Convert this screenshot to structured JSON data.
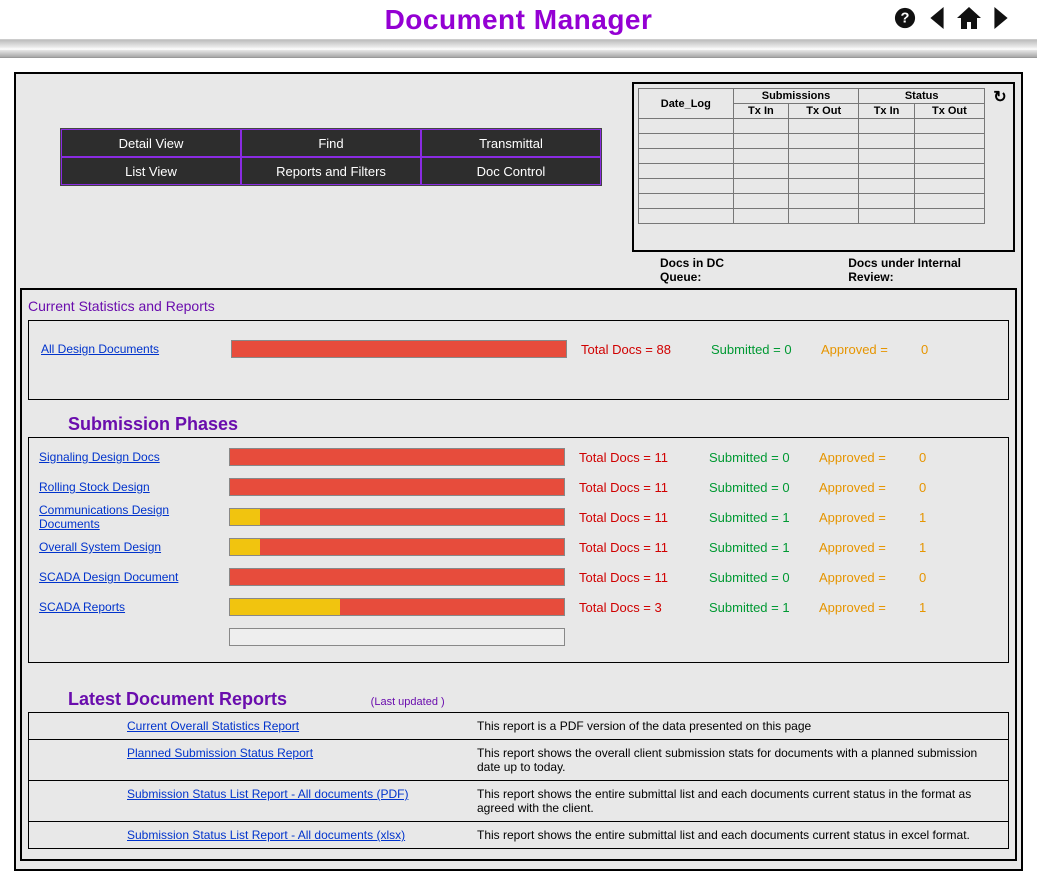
{
  "title": "Document Manager",
  "buttons": {
    "r1c1": "Detail View",
    "r1c2": "Find",
    "r1c3": "Transmittal",
    "r2c1": "List View",
    "r2c2": "Reports and Filters",
    "r2c3": "Doc Control"
  },
  "status_table": {
    "group1": "Submissions",
    "group2": "Status",
    "col_date": "Date_Log",
    "col_txin": "Tx In",
    "col_txout": "Tx Out",
    "col_txin2": "Tx In",
    "col_txout2": "Tx Out"
  },
  "footer": {
    "dc_queue_label": "Docs in DC Queue:",
    "internal_label": "Docs under Internal Review:"
  },
  "stats_title": "Current Statistics and Reports",
  "all_design": {
    "label": "All Design Documents",
    "total": "Total Docs = 88",
    "submitted": "Submitted =  0",
    "approved_lbl": "Approved =",
    "approved_val": "0"
  },
  "phases_title": "Submission Phases",
  "phases": [
    {
      "label": "Signaling Design Docs",
      "total": "Total Docs = 11",
      "submitted": "Submitted = 0",
      "appr_lbl": "Approved =",
      "appr": "0",
      "orange": 0,
      "red": 100
    },
    {
      "label": "Rolling Stock Design",
      "total": "Total Docs = 11",
      "submitted": "Submitted = 0",
      "appr_lbl": "Approved =",
      "appr": "0",
      "orange": 0,
      "red": 100
    },
    {
      "label": "Communications Design Documents",
      "total": "Total Docs = 11",
      "submitted": "Submitted = 1",
      "appr_lbl": "Approved =",
      "appr": "1",
      "orange": 9,
      "red": 91
    },
    {
      "label": "Overall System Design",
      "total": "Total Docs = 11",
      "submitted": "Submitted = 1",
      "appr_lbl": "Approved =",
      "appr": "1",
      "orange": 9,
      "red": 91
    },
    {
      "label": "SCADA Design Document",
      "total": "Total Docs = 11",
      "submitted": "Submitted = 0",
      "appr_lbl": "Approved =",
      "appr": "0",
      "orange": 0,
      "red": 100
    },
    {
      "label": "SCADA Reports",
      "total": "Total Docs = 3",
      "submitted": "Submitted = 1",
      "appr_lbl": "Approved =",
      "appr": "1",
      "orange": 33,
      "red": 67
    }
  ],
  "ldr_title": "Latest Document Reports",
  "last_updated": "(Last updated )",
  "reports": [
    {
      "link": "Current Overall Statistics Report",
      "desc": "This report is a PDF version of the data presented on this page"
    },
    {
      "link": "Planned Submission Status Report",
      "desc": "This report shows the overall client submission stats for documents with a planned submission date up to today."
    },
    {
      "link": "Submission Status List Report - All documents (PDF)",
      "desc": "This report shows the entire submittal list and each documents current status in the format as agreed with the client."
    },
    {
      "link": "Submission Status List Report - All documents (xlsx)",
      "desc": "This report shows the entire submittal list and each documents current status in excel format."
    }
  ],
  "chart_data": {
    "type": "bar",
    "note": "Horizontal stacked bars per document category. orange% = submitted/approved portion, red% = remaining; numbers derived from submitted/total counts.",
    "rows": [
      {
        "name": "All Design Documents",
        "total": 88,
        "submitted": 0,
        "approved": 0
      },
      {
        "name": "Signaling Design Docs",
        "total": 11,
        "submitted": 0,
        "approved": 0
      },
      {
        "name": "Rolling Stock Design",
        "total": 11,
        "submitted": 0,
        "approved": 0
      },
      {
        "name": "Communications Design Documents",
        "total": 11,
        "submitted": 1,
        "approved": 1
      },
      {
        "name": "Overall System Design",
        "total": 11,
        "submitted": 1,
        "approved": 1
      },
      {
        "name": "SCADA Design Document",
        "total": 11,
        "submitted": 0,
        "approved": 0
      },
      {
        "name": "SCADA Reports",
        "total": 3,
        "submitted": 1,
        "approved": 1
      }
    ]
  }
}
